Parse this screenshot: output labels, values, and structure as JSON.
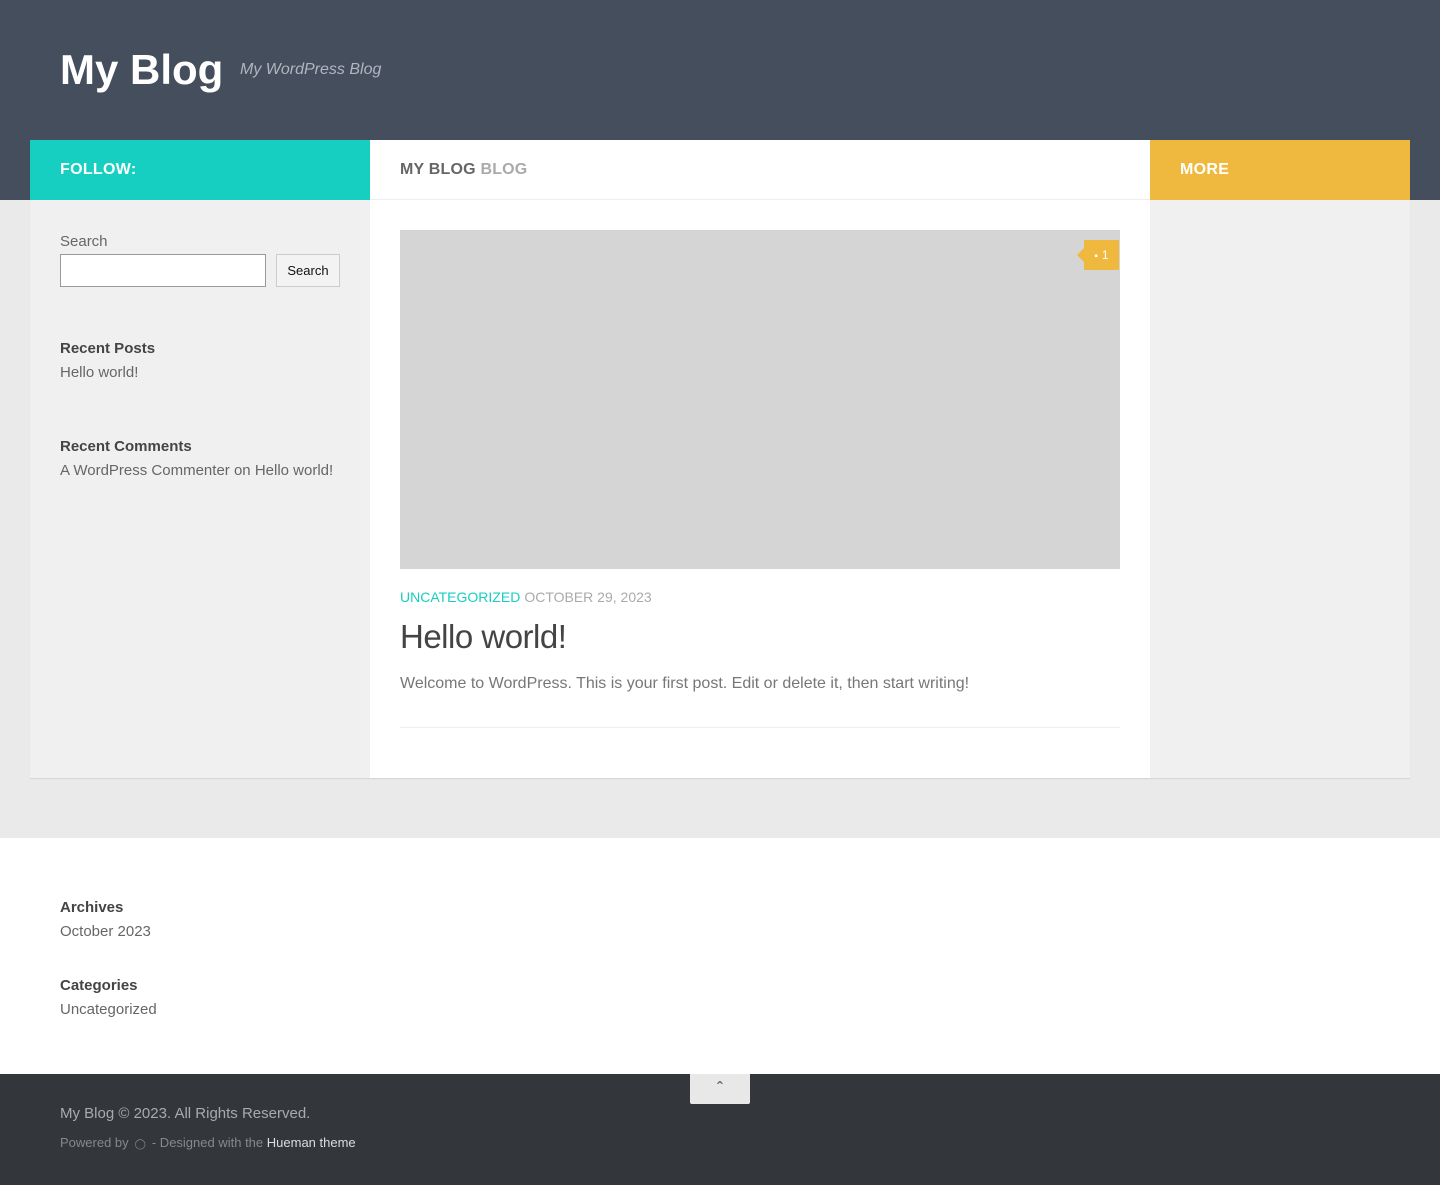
{
  "header": {
    "site_title": "My Blog",
    "site_description": "My WordPress Blog",
    "bg_color": "#454e5c"
  },
  "sidebar_left": {
    "header_label": "FOLLOW:",
    "header_color": "#16cfc1",
    "search": {
      "label": "Search",
      "value": "",
      "button_label": "Search"
    },
    "recent_posts": {
      "title": "Recent Posts",
      "items": [
        "Hello world!"
      ]
    },
    "recent_comments": {
      "title": "Recent Comments",
      "author": "A WordPress Commenter",
      "connector": " on ",
      "post": "Hello world!"
    }
  },
  "main": {
    "page_title_main": "MY BLOG",
    "page_title_sub": "BLOG",
    "post": {
      "comment_count": "1",
      "comment_icon": "comment-icon",
      "category": "UNCATEGORIZED",
      "date": "OCTOBER 29, 2023",
      "title": "Hello world!",
      "excerpt": "Welcome to WordPress. This is your first post. Edit or delete it, then start writing!"
    }
  },
  "sidebar_right": {
    "header_label": "MORE",
    "header_color": "#efb93f"
  },
  "footer_widgets": {
    "archives": {
      "title": "Archives",
      "items": [
        "October 2023"
      ]
    },
    "categories": {
      "title": "Categories",
      "items": [
        "Uncategorized"
      ]
    }
  },
  "footer": {
    "back_to_top_icon": "chevron-up-icon",
    "copyright": "My Blog © 2023. All Rights Reserved.",
    "powered_by": "Powered by",
    "wordpress_icon": "wordpress-icon",
    "designed_with": "- Designed with the",
    "theme_name": "Hueman theme"
  }
}
